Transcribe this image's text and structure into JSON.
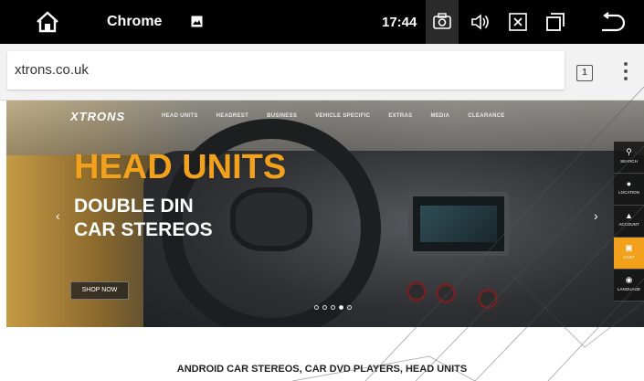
{
  "system_bar": {
    "app_title": "Chrome",
    "time": "17:44",
    "icons": [
      "home-icon",
      "image-icon",
      "camera-icon",
      "volume-icon",
      "close-box-icon",
      "recent-apps-icon",
      "back-icon"
    ]
  },
  "browser": {
    "url": "xtrons.co.uk",
    "tab_count": "1",
    "menu_icon": "more-vert-icon"
  },
  "hero": {
    "brand": "XTRONS",
    "nav_items": [
      "HEAD UNITS",
      "HEADREST",
      "BUSINESS",
      "VEHICLE SPECIFIC",
      "EXTRAS",
      "MEDIA",
      "CLEARANCE"
    ],
    "title": "HEAD UNITS",
    "subtitle_line1": "DOUBLE DIN",
    "subtitle_line2": "CAR STEREOS",
    "cta": "SHOP NOW",
    "slide_count": 5,
    "active_slide": 4,
    "accent_color": "#f2a11c"
  },
  "side_widget": {
    "items": [
      {
        "label": "SEARCH",
        "icon": "search-icon"
      },
      {
        "label": "LOCATION",
        "icon": "location-icon"
      },
      {
        "label": "ACCOUNT",
        "icon": "account-icon"
      },
      {
        "label": "CART",
        "icon": "cart-icon"
      },
      {
        "label": "LANGUAGE",
        "icon": "globe-icon"
      }
    ]
  },
  "footer_heading": "ANDROID CAR STEREOS, CAR DVD PLAYERS, HEAD UNITS"
}
